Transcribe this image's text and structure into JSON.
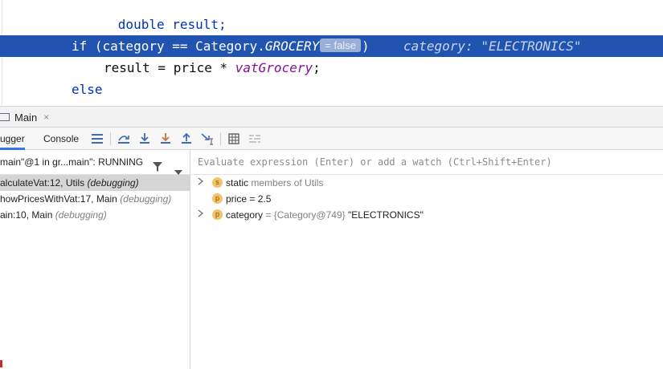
{
  "editor": {
    "line1": "double result;",
    "line3": {
      "kw_if": "if",
      "before_const": " (category == Category.",
      "const": "GROCERY",
      "inline_value": "= false",
      "after": ")",
      "hint": "category: \"ELECTRONICS\""
    },
    "line4": {
      "before": "result = price * ",
      "field": "vatGrocery",
      "after": ";"
    },
    "line5": "else"
  },
  "tool_window": {
    "run_tab": "Main",
    "close_glyph": "×"
  },
  "toolbar": {
    "debugger_tab": "ugger",
    "console_tab": "Console"
  },
  "frames": {
    "thread": "main\"@1 in gr...main\": RUNNING",
    "items": [
      {
        "name": "alculateVat:12, Utils",
        "status": "(debugging)"
      },
      {
        "name": "howPricesWithVat:17, Main",
        "status": "(debugging)"
      },
      {
        "name": "ain:10, Main",
        "status": "(debugging)"
      }
    ]
  },
  "variables": {
    "placeholder": "Evaluate expression (Enter) or add a watch (Ctrl+Shift+Enter)",
    "rows": [
      {
        "badge": "s",
        "name": "static",
        "value": "members of Utils"
      },
      {
        "badge": "p",
        "name": "price",
        "value": "= 2.5"
      },
      {
        "badge": "p",
        "name": "category",
        "value_ref": "= {Category@749}",
        "value_str": "\"ELECTRONICS\""
      }
    ]
  },
  "colors": {
    "selection": "#2154b0",
    "keyword": "#0033b3",
    "field": "#871094",
    "variable_badge": "#f4c26b",
    "accent": "#3574f0"
  }
}
